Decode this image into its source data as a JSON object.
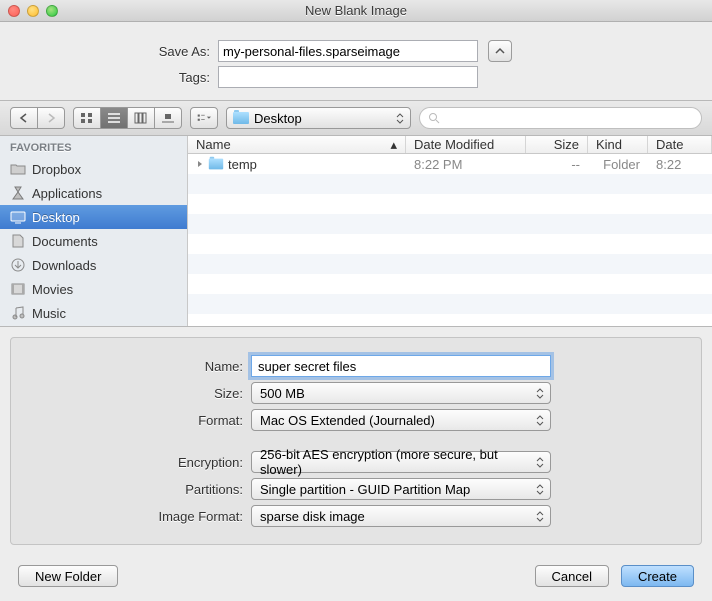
{
  "window": {
    "title": "New Blank Image"
  },
  "save": {
    "saveAsLabel": "Save As:",
    "saveAsValue": "my-personal-files.sparseimage",
    "tagsLabel": "Tags:",
    "tagsValue": ""
  },
  "toolbar": {
    "location": "Desktop",
    "searchPlaceholder": ""
  },
  "sidebar": {
    "header": "FAVORITES",
    "items": [
      {
        "label": "Dropbox",
        "icon": "folder"
      },
      {
        "label": "Applications",
        "icon": "apps"
      },
      {
        "label": "Desktop",
        "icon": "desktop",
        "selected": true
      },
      {
        "label": "Documents",
        "icon": "documents"
      },
      {
        "label": "Downloads",
        "icon": "downloads"
      },
      {
        "label": "Movies",
        "icon": "movies"
      },
      {
        "label": "Music",
        "icon": "music"
      }
    ]
  },
  "list": {
    "headers": {
      "name": "Name",
      "date": "Date Modified",
      "size": "Size",
      "kind": "Kind",
      "extra": "Date"
    },
    "rows": [
      {
        "name": "temp",
        "date": "8:22 PM",
        "size": "--",
        "kind": "Folder",
        "extra": "8:22"
      }
    ]
  },
  "options": {
    "nameLabel": "Name:",
    "nameValue": "super secret files",
    "sizeLabel": "Size:",
    "sizeValue": "500 MB",
    "formatLabel": "Format:",
    "formatValue": "Mac OS Extended (Journaled)",
    "encryptionLabel": "Encryption:",
    "encryptionValue": "256-bit AES encryption (more secure, but slower)",
    "partitionsLabel": "Partitions:",
    "partitionsValue": "Single partition - GUID Partition Map",
    "imageFormatLabel": "Image Format:",
    "imageFormatValue": "sparse disk image"
  },
  "footer": {
    "newFolder": "New Folder",
    "cancel": "Cancel",
    "create": "Create"
  }
}
